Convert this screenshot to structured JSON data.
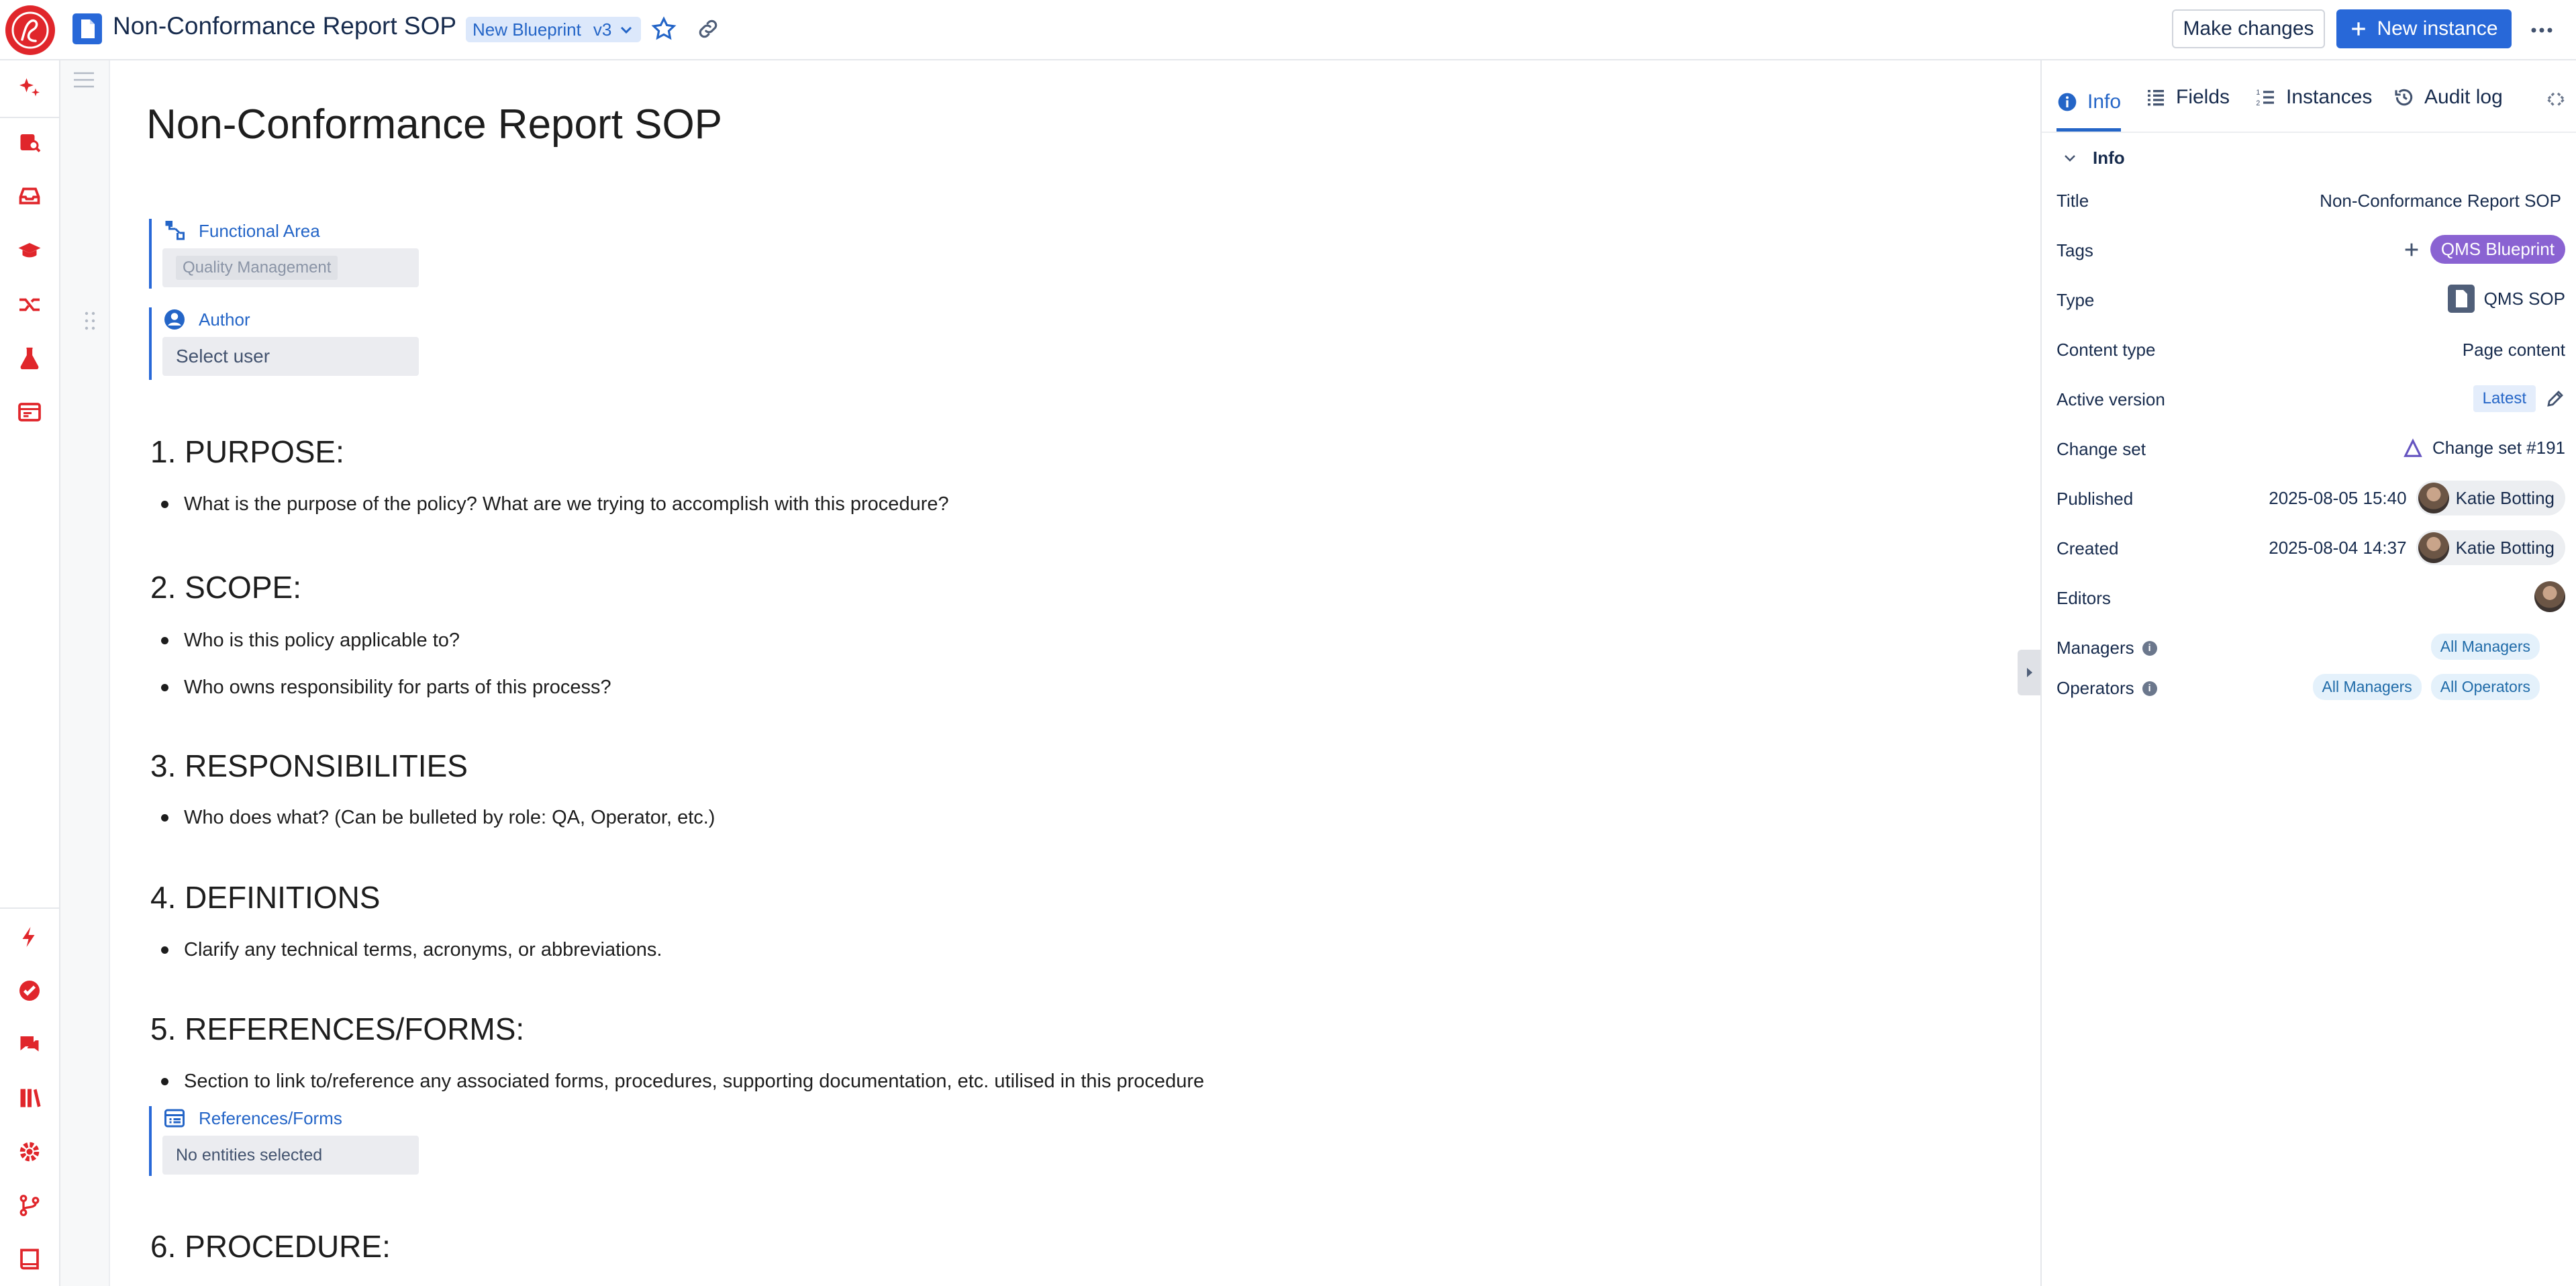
{
  "header": {
    "page_title": "Non-Conformance Report SOP",
    "blueprint_label": "New Blueprint",
    "version": "v3",
    "make_changes": "Make changes",
    "new_instance": "New instance"
  },
  "document": {
    "title": "Non-Conformance Report SOP",
    "fields": {
      "functional_area": {
        "label": "Functional Area",
        "value": "Quality Management"
      },
      "author": {
        "label": "Author",
        "placeholder": "Select user"
      },
      "references": {
        "label": "References/Forms",
        "value": "No entities selected"
      }
    },
    "sections": [
      {
        "heading": "1. PURPOSE:",
        "bullets": [
          "What is the purpose of the policy? What are we trying to accomplish with this procedure?"
        ]
      },
      {
        "heading": "2. SCOPE:",
        "bullets": [
          "Who is this policy applicable to?",
          "Who owns responsibility for parts of this process?"
        ]
      },
      {
        "heading": "3. RESPONSIBILITIES",
        "bullets": [
          "Who does what? (Can be bulleted by role: QA, Operator, etc.)"
        ]
      },
      {
        "heading": "4. DEFINITIONS",
        "bullets": [
          "Clarify any technical terms, acronyms, or abbreviations."
        ]
      },
      {
        "heading": "5. REFERENCES/FORMS:",
        "bullets": [
          "Section to link to/reference any associated forms, procedures, supporting documentation, etc. utilised in this procedure"
        ]
      },
      {
        "heading": "6. PROCEDURE:",
        "bullets": []
      }
    ]
  },
  "panel": {
    "tabs": [
      "Info",
      "Fields",
      "Instances",
      "Audit log"
    ],
    "section": "Info",
    "rows": {
      "title": {
        "label": "Title",
        "value": "Non-Conformance Report SOP"
      },
      "tags": {
        "label": "Tags",
        "value": "QMS Blueprint"
      },
      "type": {
        "label": "Type",
        "value": "QMS SOP"
      },
      "content_type": {
        "label": "Content type",
        "value": "Page content"
      },
      "active_version": {
        "label": "Active version",
        "value": "Latest"
      },
      "change_set": {
        "label": "Change set",
        "value": "Change set #191"
      },
      "published": {
        "label": "Published",
        "date": "2025-08-05 15:40",
        "user": "Katie Botting"
      },
      "created": {
        "label": "Created",
        "date": "2025-08-04 14:37",
        "user": "Katie Botting"
      },
      "editors": {
        "label": "Editors"
      },
      "managers": {
        "label": "Managers",
        "teams": [
          "All Managers"
        ]
      },
      "operators": {
        "label": "Operators",
        "teams": [
          "All Managers",
          "All Operators"
        ]
      }
    }
  },
  "colors": {
    "brand": "#e0262b",
    "accent": "#2868d8",
    "tag": "#8a63d2"
  }
}
